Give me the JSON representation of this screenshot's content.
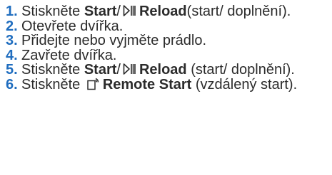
{
  "steps": [
    {
      "num": "1.",
      "pre": "Stiskněte ",
      "bold1": "Start",
      "slash": "/",
      "icon": "play-pause-icon",
      "bold2": "Reload",
      "post": "(start/ doplnění)."
    },
    {
      "num": "2.",
      "text": "Otevřete dvířka."
    },
    {
      "num": "3.",
      "text": "Přidejte nebo vyjměte prádlo."
    },
    {
      "num": "4.",
      "text": "Zavřete dvířka."
    },
    {
      "num": "5.",
      "pre": "Stiskněte ",
      "bold1": "Start",
      "slash": "/",
      "icon": "play-pause-icon",
      "bold2": "Reload",
      "post": " (start/ doplnění)."
    },
    {
      "num": "6.",
      "pre": "Stiskněte ",
      "icon": "remote-start-icon",
      "bold": "Remote Start",
      "post": " (vzdálený start)."
    }
  ],
  "colors": {
    "number": "#1f6dbf",
    "text": "#2b2b2b"
  }
}
